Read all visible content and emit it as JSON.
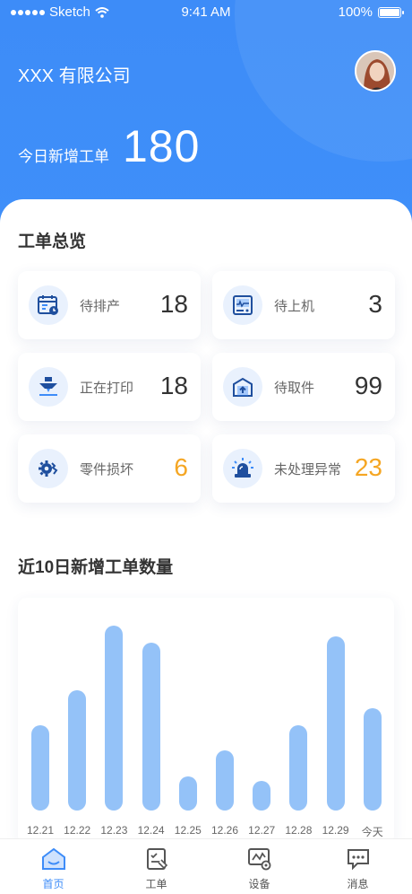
{
  "status_bar": {
    "carrier": "Sketch",
    "time": "9:41 AM",
    "battery": "100%"
  },
  "header": {
    "company": "XXX 有限公司",
    "new_orders_label": "今日新增工单",
    "new_orders_count": "180"
  },
  "overview": {
    "title": "工单总览",
    "cards": [
      {
        "label": "待排产",
        "count": "18",
        "icon": "calendar-icon"
      },
      {
        "label": "待上机",
        "count": "3",
        "icon": "machine-icon"
      },
      {
        "label": "正在打印",
        "count": "18",
        "icon": "printer-nozzle-icon"
      },
      {
        "label": "待取件",
        "count": "99",
        "icon": "pickup-box-icon"
      },
      {
        "label": "零件损坏",
        "count": "6",
        "icon": "broken-part-icon",
        "warn": true
      },
      {
        "label": "未处理异常",
        "count": "23",
        "icon": "alarm-light-icon",
        "warn": true
      }
    ]
  },
  "colors": {
    "primary": "#3d8cf8",
    "bar": "#94c2f8",
    "warn": "#f5a623"
  },
  "chart_section": {
    "title": "近10日新增工单数量"
  },
  "chart_data": {
    "type": "bar",
    "categories": [
      "12.21",
      "12.22",
      "12.23",
      "12.24",
      "12.25",
      "12.26",
      "12.27",
      "12.28",
      "12.29",
      "今天"
    ],
    "values": [
      95,
      133,
      205,
      186,
      38,
      67,
      33,
      95,
      193,
      113
    ],
    "ylim": [
      0,
      205
    ],
    "grid": false,
    "legend": "none"
  },
  "tabbar": {
    "items": [
      {
        "label": "首页",
        "icon": "home-icon",
        "active": true
      },
      {
        "label": "工单",
        "icon": "work-order-icon",
        "active": false
      },
      {
        "label": "设备",
        "icon": "device-icon",
        "active": false
      },
      {
        "label": "消息",
        "icon": "message-icon",
        "active": false
      }
    ]
  }
}
